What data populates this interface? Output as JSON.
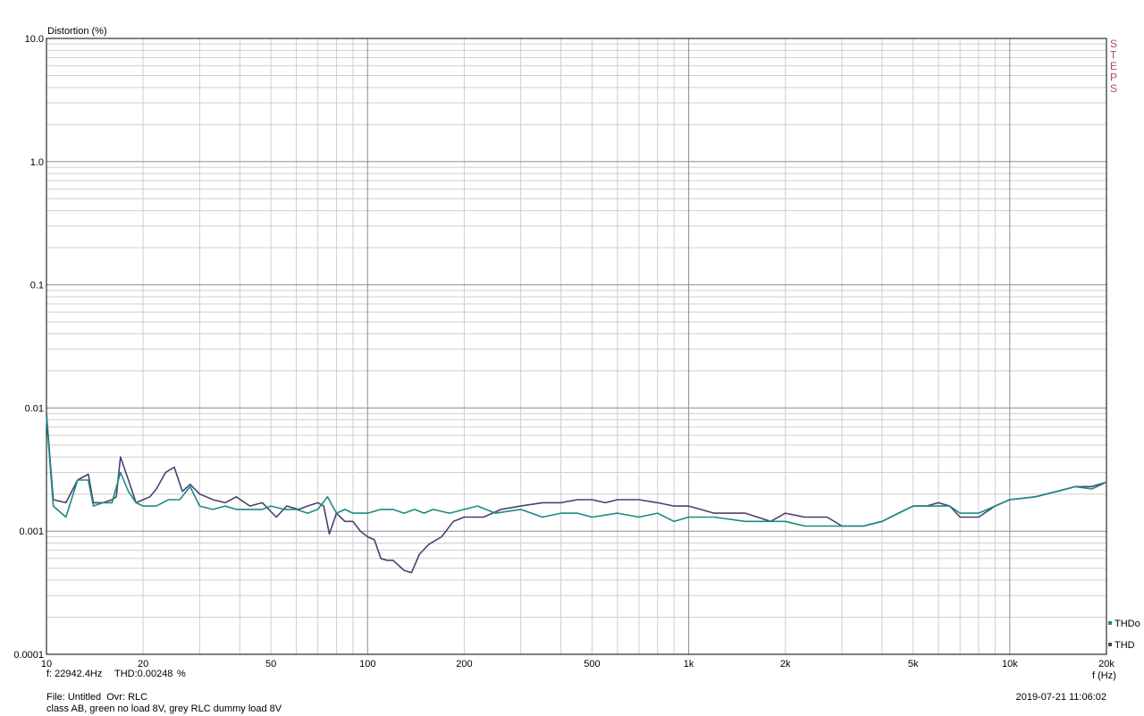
{
  "chart_data": {
    "type": "line",
    "ylabel": "Distortion (%)",
    "xlabel": "f (Hz)",
    "x_scale": "log",
    "y_scale": "log",
    "xlim": [
      10,
      20000
    ],
    "ylim": [
      0.0001,
      10
    ],
    "y_ticks": [
      {
        "v": 10,
        "label": "10.0"
      },
      {
        "v": 1,
        "label": "1.0"
      },
      {
        "v": 0.1,
        "label": "0.1"
      },
      {
        "v": 0.01,
        "label": "0.01"
      },
      {
        "v": 0.001,
        "label": "0.001"
      },
      {
        "v": 0.0001,
        "label": "0.0001"
      }
    ],
    "x_ticks": [
      {
        "v": 10,
        "label": "10"
      },
      {
        "v": 20,
        "label": "20"
      },
      {
        "v": 50,
        "label": "50"
      },
      {
        "v": 100,
        "label": "100"
      },
      {
        "v": 200,
        "label": "200"
      },
      {
        "v": 500,
        "label": "500"
      },
      {
        "v": 1000,
        "label": "1k"
      },
      {
        "v": 2000,
        "label": "2k"
      },
      {
        "v": 5000,
        "label": "5k"
      },
      {
        "v": 10000,
        "label": "10k"
      },
      {
        "v": 20000,
        "label": "20k"
      }
    ],
    "grid": true,
    "side_label": "STEPS",
    "legend_position": "bottom-right",
    "series": [
      {
        "name": "THD",
        "color": "#4b3f72",
        "points": [
          [
            10,
            0.009
          ],
          [
            10.5,
            0.0018
          ],
          [
            11.5,
            0.0017
          ],
          [
            12.5,
            0.0026
          ],
          [
            13.5,
            0.0029
          ],
          [
            14,
            0.0017
          ],
          [
            15,
            0.0017
          ],
          [
            16,
            0.0018
          ],
          [
            16.5,
            0.0019
          ],
          [
            17,
            0.004
          ],
          [
            18,
            0.0026
          ],
          [
            19,
            0.0017
          ],
          [
            21,
            0.0019
          ],
          [
            22,
            0.0022
          ],
          [
            23.5,
            0.003
          ],
          [
            25,
            0.0033
          ],
          [
            26.5,
            0.0021
          ],
          [
            28,
            0.0024
          ],
          [
            30,
            0.002
          ],
          [
            33,
            0.0018
          ],
          [
            36,
            0.0017
          ],
          [
            39,
            0.0019
          ],
          [
            43,
            0.0016
          ],
          [
            47,
            0.0017
          ],
          [
            52,
            0.0013
          ],
          [
            56,
            0.0016
          ],
          [
            61,
            0.0015
          ],
          [
            65,
            0.0016
          ],
          [
            70,
            0.0017
          ],
          [
            73,
            0.0016
          ],
          [
            76,
            0.00095
          ],
          [
            80,
            0.0014
          ],
          [
            85,
            0.0012
          ],
          [
            90,
            0.0012
          ],
          [
            95,
            0.001
          ],
          [
            100,
            0.0009
          ],
          [
            105,
            0.00085
          ],
          [
            110,
            0.0006
          ],
          [
            115,
            0.00058
          ],
          [
            120,
            0.00058
          ],
          [
            130,
            0.00048
          ],
          [
            137,
            0.00046
          ],
          [
            145,
            0.00065
          ],
          [
            155,
            0.00078
          ],
          [
            170,
            0.0009
          ],
          [
            185,
            0.0012
          ],
          [
            200,
            0.0013
          ],
          [
            230,
            0.0013
          ],
          [
            260,
            0.0015
          ],
          [
            300,
            0.0016
          ],
          [
            350,
            0.0017
          ],
          [
            400,
            0.0017
          ],
          [
            450,
            0.0018
          ],
          [
            500,
            0.0018
          ],
          [
            550,
            0.0017
          ],
          [
            600,
            0.0018
          ],
          [
            700,
            0.0018
          ],
          [
            800,
            0.0017
          ],
          [
            900,
            0.0016
          ],
          [
            1000,
            0.0016
          ],
          [
            1200,
            0.0014
          ],
          [
            1500,
            0.0014
          ],
          [
            1800,
            0.0012
          ],
          [
            2000,
            0.0014
          ],
          [
            2300,
            0.0013
          ],
          [
            2700,
            0.0013
          ],
          [
            3000,
            0.0011
          ],
          [
            3500,
            0.0011
          ],
          [
            4000,
            0.0012
          ],
          [
            4500,
            0.0014
          ],
          [
            5000,
            0.0016
          ],
          [
            5500,
            0.0016
          ],
          [
            6000,
            0.0017
          ],
          [
            6500,
            0.0016
          ],
          [
            7000,
            0.0013
          ],
          [
            8000,
            0.0013
          ],
          [
            9000,
            0.0016
          ],
          [
            10000,
            0.0018
          ],
          [
            12000,
            0.0019
          ],
          [
            14000,
            0.0021
          ],
          [
            16000,
            0.0023
          ],
          [
            18000,
            0.0023
          ],
          [
            20000,
            0.0025
          ]
        ]
      },
      {
        "name": "THDo",
        "color": "#1d8a82",
        "points": [
          [
            10,
            0.0085
          ],
          [
            10.5,
            0.0016
          ],
          [
            11.5,
            0.0013
          ],
          [
            12.5,
            0.0026
          ],
          [
            13.5,
            0.0026
          ],
          [
            14,
            0.0016
          ],
          [
            15,
            0.0017
          ],
          [
            16,
            0.0017
          ],
          [
            17,
            0.003
          ],
          [
            18,
            0.0021
          ],
          [
            19,
            0.0017
          ],
          [
            20,
            0.0016
          ],
          [
            22,
            0.0016
          ],
          [
            24,
            0.0018
          ],
          [
            26,
            0.0018
          ],
          [
            28,
            0.0023
          ],
          [
            30,
            0.0016
          ],
          [
            33,
            0.0015
          ],
          [
            36,
            0.0016
          ],
          [
            39,
            0.0015
          ],
          [
            43,
            0.0015
          ],
          [
            47,
            0.0015
          ],
          [
            50,
            0.0016
          ],
          [
            55,
            0.0015
          ],
          [
            60,
            0.0015
          ],
          [
            65,
            0.0014
          ],
          [
            70,
            0.0015
          ],
          [
            75,
            0.0019
          ],
          [
            80,
            0.0014
          ],
          [
            85,
            0.0015
          ],
          [
            90,
            0.0014
          ],
          [
            100,
            0.0014
          ],
          [
            110,
            0.0015
          ],
          [
            120,
            0.0015
          ],
          [
            130,
            0.0014
          ],
          [
            140,
            0.0015
          ],
          [
            150,
            0.0014
          ],
          [
            160,
            0.0015
          ],
          [
            180,
            0.0014
          ],
          [
            200,
            0.0015
          ],
          [
            220,
            0.0016
          ],
          [
            250,
            0.0014
          ],
          [
            300,
            0.0015
          ],
          [
            350,
            0.0013
          ],
          [
            400,
            0.0014
          ],
          [
            450,
            0.0014
          ],
          [
            500,
            0.0013
          ],
          [
            600,
            0.0014
          ],
          [
            700,
            0.0013
          ],
          [
            800,
            0.0014
          ],
          [
            900,
            0.0012
          ],
          [
            1000,
            0.0013
          ],
          [
            1200,
            0.0013
          ],
          [
            1500,
            0.0012
          ],
          [
            1800,
            0.0012
          ],
          [
            2000,
            0.0012
          ],
          [
            2300,
            0.0011
          ],
          [
            2700,
            0.0011
          ],
          [
            3000,
            0.0011
          ],
          [
            3500,
            0.0011
          ],
          [
            4000,
            0.0012
          ],
          [
            4500,
            0.0014
          ],
          [
            5000,
            0.0016
          ],
          [
            5500,
            0.0016
          ],
          [
            6000,
            0.0016
          ],
          [
            6500,
            0.0016
          ],
          [
            7000,
            0.0014
          ],
          [
            8000,
            0.0014
          ],
          [
            9000,
            0.0016
          ],
          [
            10000,
            0.0018
          ],
          [
            12000,
            0.0019
          ],
          [
            14000,
            0.0021
          ],
          [
            16000,
            0.0023
          ],
          [
            18000,
            0.0022
          ],
          [
            20000,
            0.0025
          ]
        ]
      }
    ]
  },
  "readout": {
    "frequency": "f: 22942.4Hz",
    "thd": "THD:0.00248",
    "unit": "%"
  },
  "footer": {
    "file_line": "File: Untitled  Ovr: RLC",
    "description": "class AB, green no load 8V, grey RLC dummy load 8V",
    "timestamp": "2019-07-21 11:06:02"
  }
}
